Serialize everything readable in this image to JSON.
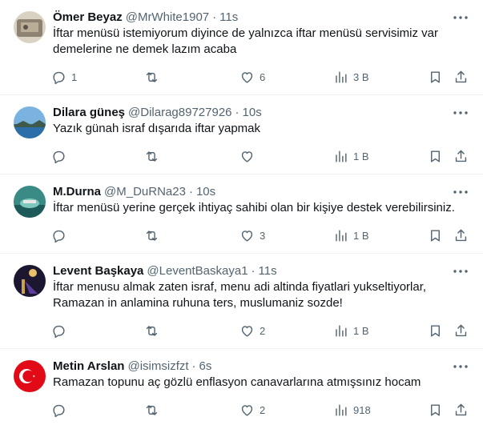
{
  "tweets": [
    {
      "name": "Ömer Beyaz",
      "handle": "@MrWhite1907",
      "dot": "·",
      "time": "11s",
      "text": "İftar menüsü istemiyorum diyince de yalnızca iftar menüsü servisimiz var\ndemelerine ne demek lazım acaba",
      "replies": "1",
      "retweets": "",
      "likes": "6",
      "views": "3 B"
    },
    {
      "name": "Dilara güneş",
      "handle": "@Dilarag89727926",
      "dot": "·",
      "time": "10s",
      "text": "Yazık günah israf dışarıda iftar yapmak",
      "replies": "",
      "retweets": "",
      "likes": "",
      "views": "1 B"
    },
    {
      "name": "M.Durna",
      "handle": "@M_DuRNa23",
      "dot": "·",
      "time": "10s",
      "text": "İftar menüsü yerine gerçek ihtiyaç sahibi olan bir kişiye destek verebilirsiniz.",
      "replies": "",
      "retweets": "",
      "likes": "3",
      "views": "1 B"
    },
    {
      "name": "Levent Başkaya",
      "handle": "@LeventBaskaya1",
      "dot": "·",
      "time": "11s",
      "text": "İftar menusu almak zaten israf, menu adi altinda fiyatlari yukseltiyorlar,\nRamazan in anlamina ruhuna ters, muslumaniz sozde!",
      "replies": "",
      "retweets": "",
      "likes": "2",
      "views": "1 B"
    },
    {
      "name": "Metin Arslan",
      "handle": "@isimsizfzt",
      "dot": "·",
      "time": "6s",
      "text": "Ramazan topunu aç gözlü enflasyon canavarlarına atmışsınız hocam",
      "replies": "",
      "retweets": "",
      "likes": "2",
      "views": "918"
    }
  ],
  "icons": {
    "more": "more-icon",
    "reply": "reply-icon",
    "retweet": "retweet-icon",
    "like": "heart-icon",
    "views": "views-icon",
    "bookmark": "bookmark-icon",
    "share": "share-icon"
  },
  "colors": {
    "text": "#0f1419",
    "muted": "#536471",
    "divider": "#eff3f4"
  }
}
